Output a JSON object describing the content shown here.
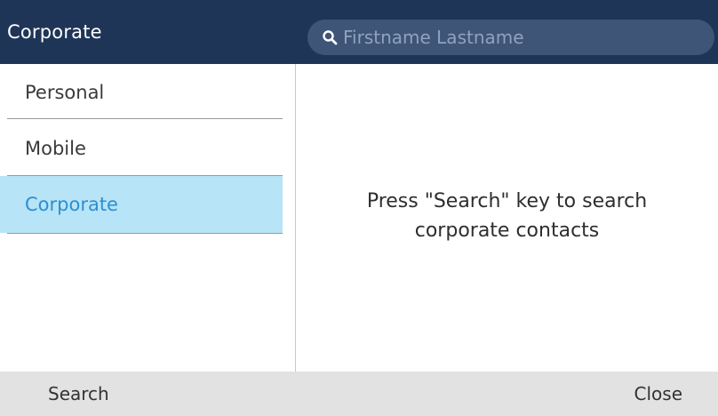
{
  "header": {
    "title": "Corporate",
    "search_placeholder": "Firstname Lastname",
    "search_icon": "search-icon"
  },
  "sidebar": {
    "items": [
      {
        "label": "Personal",
        "selected": false
      },
      {
        "label": "Mobile",
        "selected": false
      },
      {
        "label": "Corporate",
        "selected": true
      }
    ]
  },
  "content": {
    "message_line1": "Press \"Search\" key to search",
    "message_line2": "corporate contacts"
  },
  "footer": {
    "left_key": "Search",
    "right_key": "Close"
  },
  "colors": {
    "header_bg": "#1f3557",
    "search_bg": "#3f5577",
    "selected_bg": "#b7e4f6",
    "selected_text": "#2d8fd0",
    "footer_bg": "#e2e2e2"
  }
}
